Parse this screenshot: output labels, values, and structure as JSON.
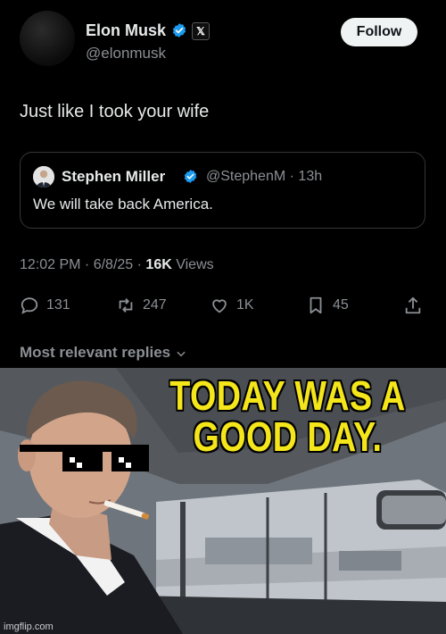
{
  "tweet": {
    "author_name": "Elon Musk",
    "author_handle": "@elonmusk",
    "follow_label": "Follow",
    "text": "Just like I took your wife",
    "quote": {
      "author_name": "Stephen Miller",
      "author_handle": "@StephenM",
      "time_ago": "· 13h",
      "text": "We will take back America."
    },
    "timestamp": "12:02 PM · 6/8/25 ·",
    "views_count": "16K",
    "views_label": "Views",
    "stats": {
      "replies": "131",
      "reposts": "247",
      "likes": "1K",
      "bookmarks": "45"
    },
    "replies_filter": "Most relevant replies"
  },
  "meme": {
    "caption_line1": "TODAY WAS A",
    "caption_line2": "GOOD DAY.",
    "watermark": "imgflip.com"
  },
  "colors": {
    "background": "#000000",
    "text_primary": "#e7e9ea",
    "text_secondary": "#8b8f94",
    "verified_blue": "#1d9bf0",
    "caption_yellow": "#f4e61a"
  },
  "icons": [
    "verified-badge-icon",
    "x-logo-icon",
    "reply-icon",
    "repost-icon",
    "like-icon",
    "bookmark-icon",
    "share-icon",
    "chevron-down-icon"
  ]
}
